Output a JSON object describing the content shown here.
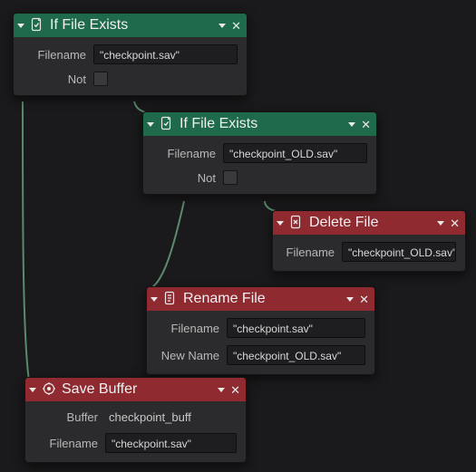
{
  "nodes": {
    "if_exists_1": {
      "title": "If File Exists",
      "fields": {
        "filename_label": "Filename",
        "filename_value": "\"checkpoint.sav\"",
        "not_label": "Not"
      }
    },
    "if_exists_2": {
      "title": "If File Exists",
      "fields": {
        "filename_label": "Filename",
        "filename_value": "\"checkpoint_OLD.sav\"",
        "not_label": "Not"
      }
    },
    "delete_file": {
      "title": "Delete File",
      "fields": {
        "filename_label": "Filename",
        "filename_value": "\"checkpoint_OLD.sav\""
      }
    },
    "rename_file": {
      "title": "Rename File",
      "fields": {
        "filename_label": "Filename",
        "filename_value": "\"checkpoint.sav\"",
        "newname_label": "New Name",
        "newname_value": "\"checkpoint_OLD.sav\""
      }
    },
    "save_buffer": {
      "title": "Save Buffer",
      "fields": {
        "buffer_label": "Buffer",
        "buffer_value": "checkpoint_buff",
        "filename_label": "Filename",
        "filename_value": "\"checkpoint.sav\""
      }
    }
  }
}
